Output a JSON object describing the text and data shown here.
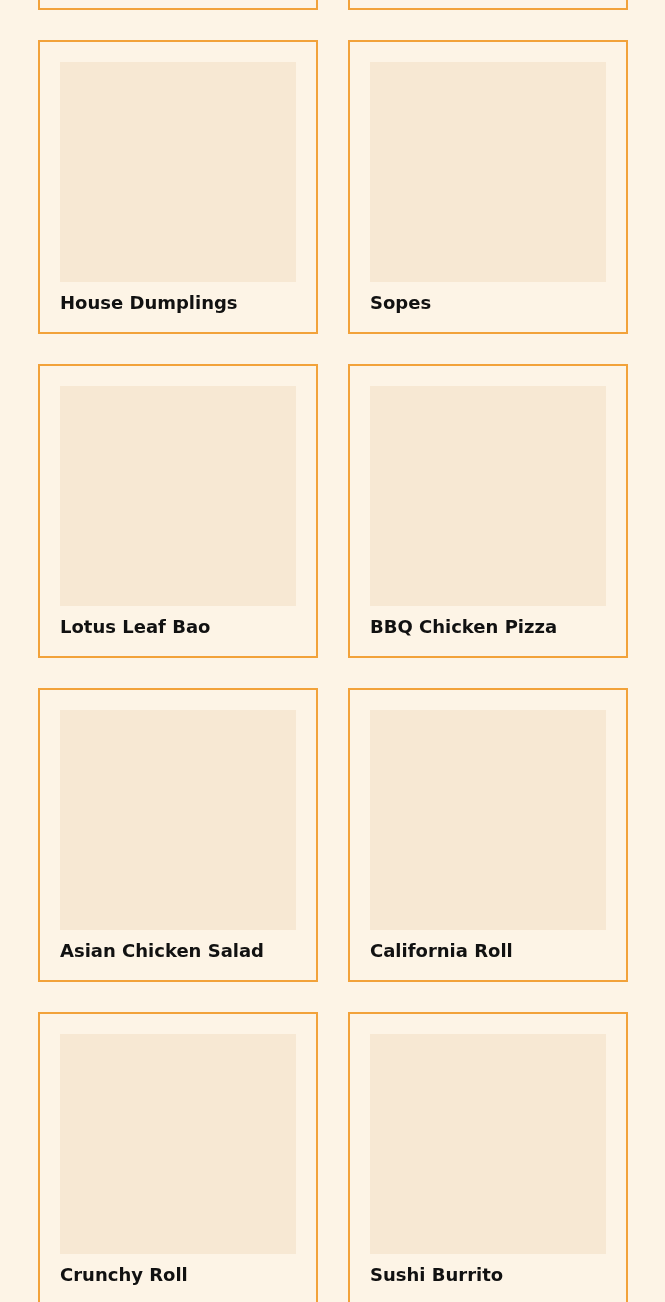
{
  "cards": [
    {
      "title": "House Dumplings"
    },
    {
      "title": "Sopes"
    },
    {
      "title": "Lotus Leaf Bao"
    },
    {
      "title": "BBQ Chicken Pizza"
    },
    {
      "title": "Asian Chicken Salad"
    },
    {
      "title": "California Roll"
    },
    {
      "title": "Crunchy Roll"
    },
    {
      "title": "Sushi Burrito"
    }
  ]
}
